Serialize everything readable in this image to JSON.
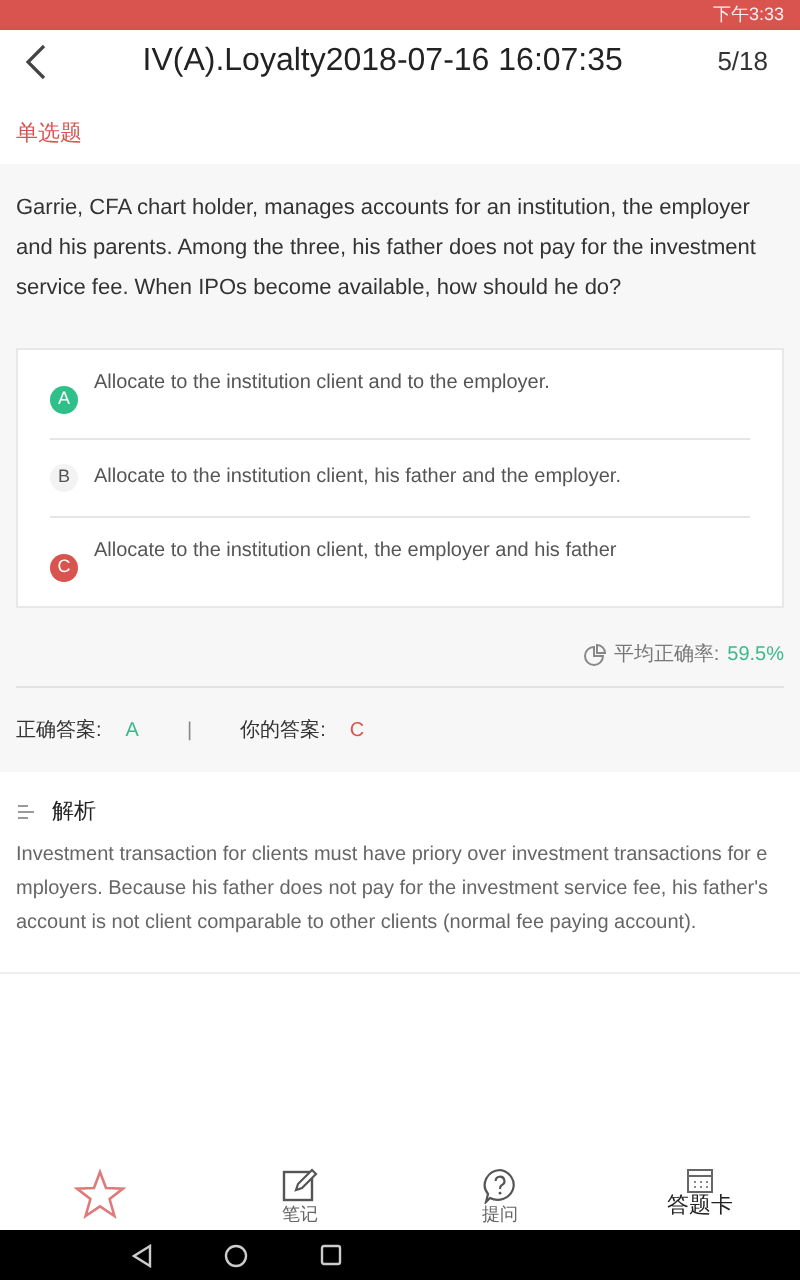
{
  "status_bar": {
    "time": "下午3:33"
  },
  "header": {
    "title": "IV(A).Loyalty2018-07-16 16:07:35",
    "progress": "5/18"
  },
  "question_type": "单选题",
  "question": "Garrie, CFA chart holder, manages accounts for an institution, the employer and his parents. Among the three, his father does not pay for the investment service fee. When IPOs become available, how should he do?",
  "options": [
    {
      "letter": "A",
      "text": "Allocate to the institution client and to the employer.",
      "correct": true,
      "chosen": false
    },
    {
      "letter": "B",
      "text": "Allocate to the institution client, his father and the employer.",
      "correct": false,
      "chosen": false
    },
    {
      "letter": "C",
      "text": "Allocate to the institution client, the employer and his father",
      "correct": false,
      "chosen": true
    }
  ],
  "average": {
    "label": "平均正确率:",
    "value": "59.5%"
  },
  "answers": {
    "correct_label": "正确答案:",
    "correct": "A",
    "separator": "|",
    "yours_label": "你的答案:",
    "yours": "C"
  },
  "analysis": {
    "title": "解析",
    "text": "Investment transaction for clients must have priory over investment transactions for employers. Because his father does not pay for the investment service fee, his father's account is not client comparable to other clients (normal fee paying account)."
  },
  "bottom_bar": [
    {
      "kind": "favorite"
    },
    {
      "kind": "note",
      "label": "笔记"
    },
    {
      "kind": "ask",
      "label": "提问"
    },
    {
      "kind": "card",
      "label": "答题卡"
    }
  ]
}
